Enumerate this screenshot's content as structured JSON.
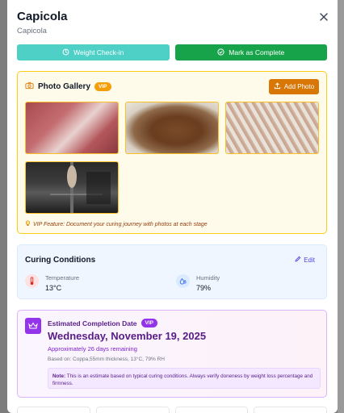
{
  "header": {
    "title": "Capicola",
    "subtitle": "Capicola"
  },
  "actions": {
    "weight_checkin": "Weight Check-in",
    "mark_complete": "Mark as Complete"
  },
  "gallery": {
    "title": "Photo Gallery",
    "badge": "VIP",
    "add_photo": "Add Photo",
    "note": "VIP Feature: Document your curing journey with photos at each stage"
  },
  "conditions": {
    "title": "Curing Conditions",
    "edit": "Edit",
    "temperature_label": "Temperature",
    "temperature_value": "13°C",
    "humidity_label": "Humidity",
    "humidity_value": "79%"
  },
  "estimate": {
    "title": "Estimated Completion Date",
    "badge": "VIP",
    "date": "Wednesday, November 19, 2025",
    "approx": "Approximately 26 days remaining",
    "based_on": "Based on: Coppa,55mm thickness, 13°C, 79% RH",
    "note_label": "Note:",
    "note_text": " This is an estimate based on typical curing conditions. Always verify doneness by weight loss percentage and firmness."
  },
  "colors": {
    "teal": "#4fd0c7",
    "green": "#16a34a",
    "amber": "#d97706",
    "purple": "#9333ea"
  }
}
